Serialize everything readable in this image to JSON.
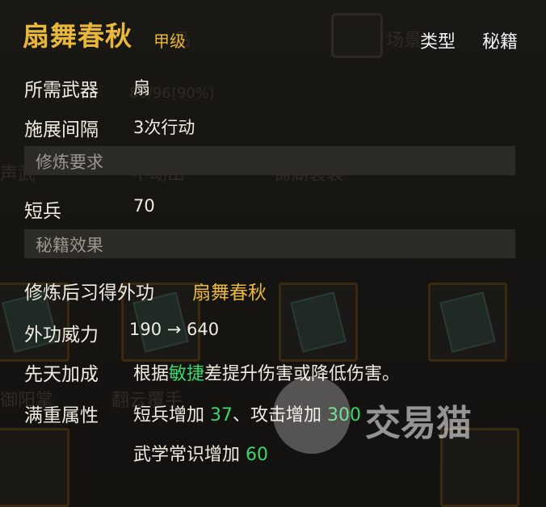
{
  "item": {
    "name": "扇舞春秋",
    "grade": "甲级",
    "type_label": "类型",
    "type_value": "秘籍"
  },
  "info": {
    "weapon_label": "所需武器",
    "weapon_value": "扇",
    "interval_label": "施展间隔",
    "interval_value": "3次行动"
  },
  "requirement": {
    "header": "修炼要求",
    "skill_label": "短兵",
    "skill_value": "70"
  },
  "effects": {
    "header": "秘籍效果",
    "learn_label": "修炼后习得外功",
    "learn_value": "扇舞春秋",
    "power_label": "外功威力",
    "power_value": "190 → 640",
    "innate_label": "先天加成",
    "innate_prefix": "根据",
    "innate_highlight": "敏捷",
    "innate_suffix": "差提升伤害或降低伤害。",
    "full_label": "满重属性",
    "full_1_text": "短兵增加 ",
    "full_1_value": "37",
    "full_sep": "、",
    "full_2_text": "攻击增加 ",
    "full_2_value": "300",
    "full_3_text": "武学常识增加 ",
    "full_3_value": "60"
  },
  "background": {
    "faint_1": "品",
    "faint_2": "场景",
    "faint_3": "86/96(90%)",
    "faint_4": "声武",
    "faint_5": "不动山",
    "faint_6": "锦湖裂袋",
    "faint_7": "???",
    "faint_8": "御阳掌",
    "faint_9": "翻云覆手"
  },
  "watermark": "交易猫",
  "colors": {
    "gold": "#e9b73a",
    "green": "#3fd66b",
    "section_bg": "#2d2b27"
  }
}
